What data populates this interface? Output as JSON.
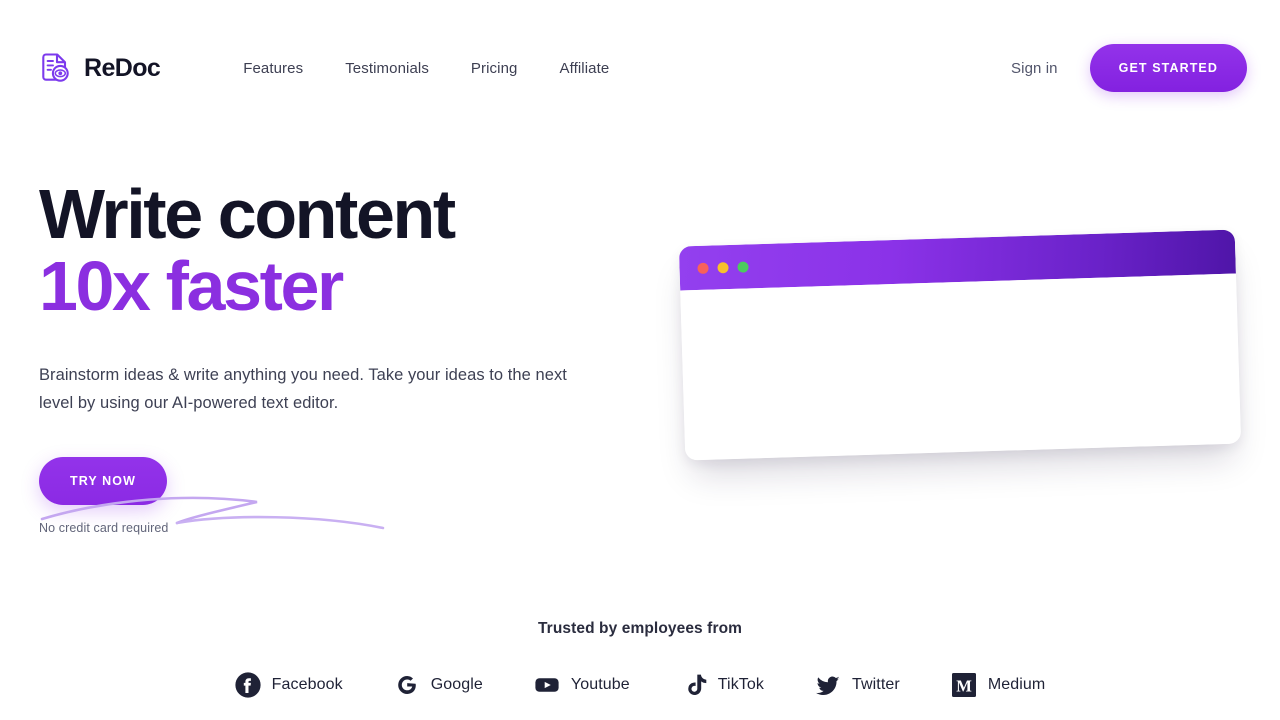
{
  "header": {
    "brand": {
      "name": "ReDoc",
      "icon": "document-eye-icon",
      "icon_color": "#7c3aed"
    },
    "nav": [
      {
        "label": "Features",
        "name": "features"
      },
      {
        "label": "Testimonials",
        "name": "testimonials"
      },
      {
        "label": "Pricing",
        "name": "pricing"
      },
      {
        "label": "Affiliate",
        "name": "affiliate"
      }
    ],
    "sign_in_label": "Sign in",
    "cta_label": "GET STARTED",
    "cta_color": "#9333EA"
  },
  "hero": {
    "headline_line1": "Write content",
    "headline_line2": "10x faster",
    "headline_accent_color": "#8B2FE0",
    "headline_color": "#131426",
    "underline_color": "#C4A7F0",
    "subhead": "Brainstorm ideas & write anything you need. Take your ideas to the next level by using our AI-powered text editor.",
    "cta_label": "TRY NOW",
    "cta_color": "#9333EA",
    "note": "No credit card required"
  },
  "mockup": {
    "name": "browser-window-illustration",
    "titlebar_gradient_from": "#9340EF",
    "titlebar_gradient_to": "#4F15A8",
    "dots": [
      {
        "name": "close-dot",
        "color": "#F8615A"
      },
      {
        "name": "minimize-dot",
        "color": "#F7C12C"
      },
      {
        "name": "maximize-dot",
        "color": "#4CCB5F"
      }
    ]
  },
  "trusted": {
    "title": "Trusted by employees from",
    "logos": [
      {
        "label": "Facebook",
        "icon": "facebook-icon"
      },
      {
        "label": "Google",
        "icon": "google-icon"
      },
      {
        "label": "Youtube",
        "icon": "youtube-icon"
      },
      {
        "label": "TikTok",
        "icon": "tiktok-icon"
      },
      {
        "label": "Twitter",
        "icon": "twitter-icon"
      },
      {
        "label": "Medium",
        "icon": "medium-icon"
      }
    ],
    "logo_color": "#1F2236"
  }
}
